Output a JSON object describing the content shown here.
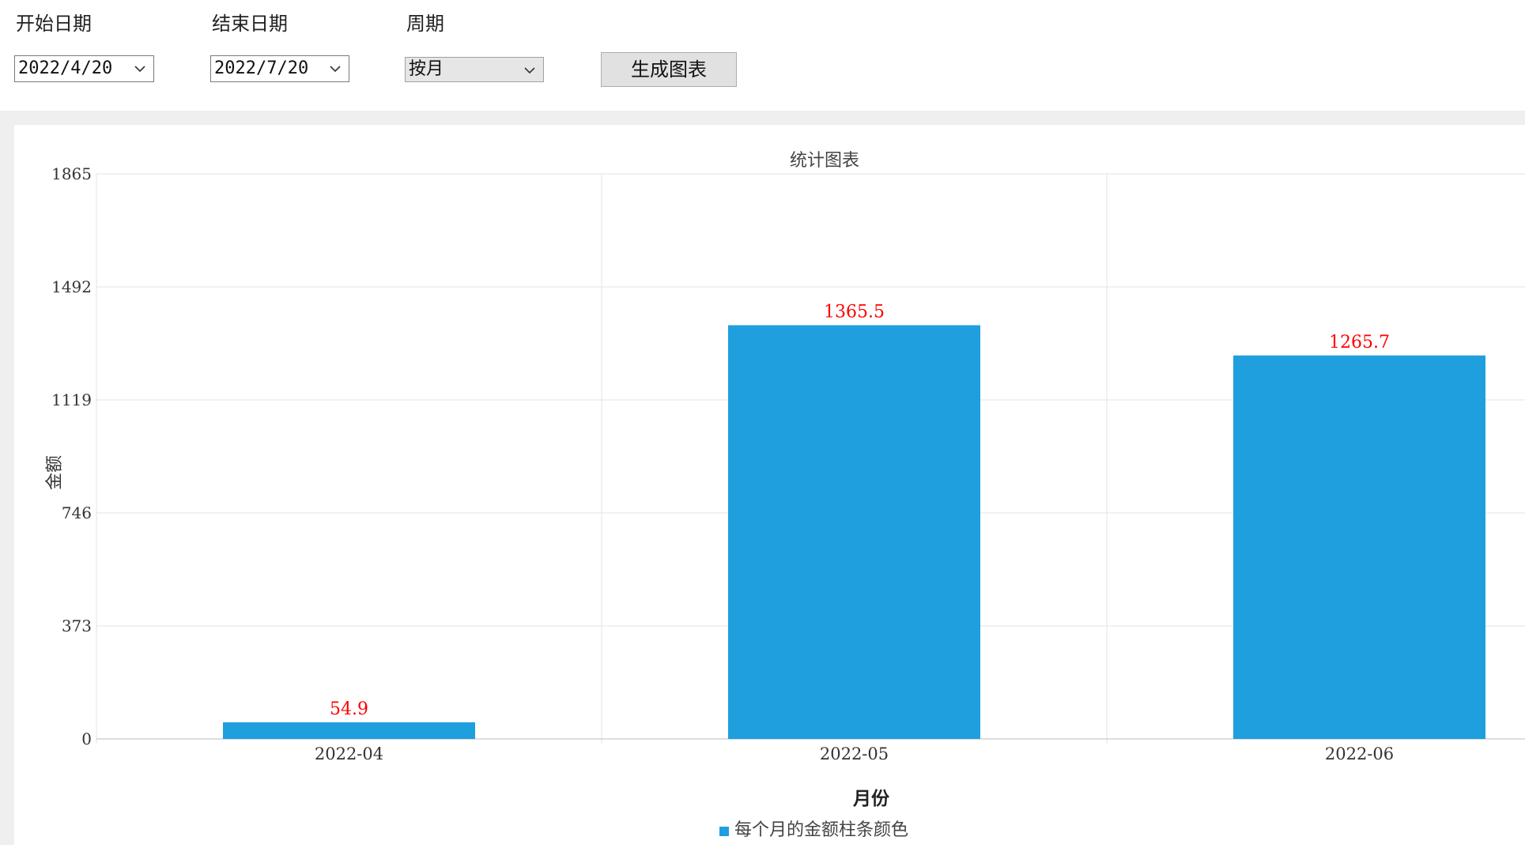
{
  "controls": {
    "start_label": "开始日期",
    "start_value": "2022/4/20",
    "end_label": "结束日期",
    "end_value": "2022/7/20",
    "period_label": "周期",
    "period_value": "按月",
    "generate_label": "生成图表"
  },
  "colors": {
    "bar": "#1f9fde",
    "data_label": "#ff0000",
    "grid": "#e3e3e3"
  },
  "chart_data": {
    "type": "bar",
    "title": "统计图表",
    "xlabel": "月份",
    "ylabel": "金额",
    "categories": [
      "2022-04",
      "2022-05",
      "2022-06"
    ],
    "series": [
      {
        "name": "每个月的金额柱条颜色",
        "values": [
          54.9,
          1365.5,
          1265.7
        ]
      }
    ],
    "data_labels": [
      "54.9",
      "1365.5",
      "1265.7"
    ],
    "yticks": [
      0,
      373,
      746,
      1119,
      1492,
      1865
    ],
    "ylim": [
      0,
      1865
    ],
    "grid": true,
    "legend_position": "bottom"
  }
}
